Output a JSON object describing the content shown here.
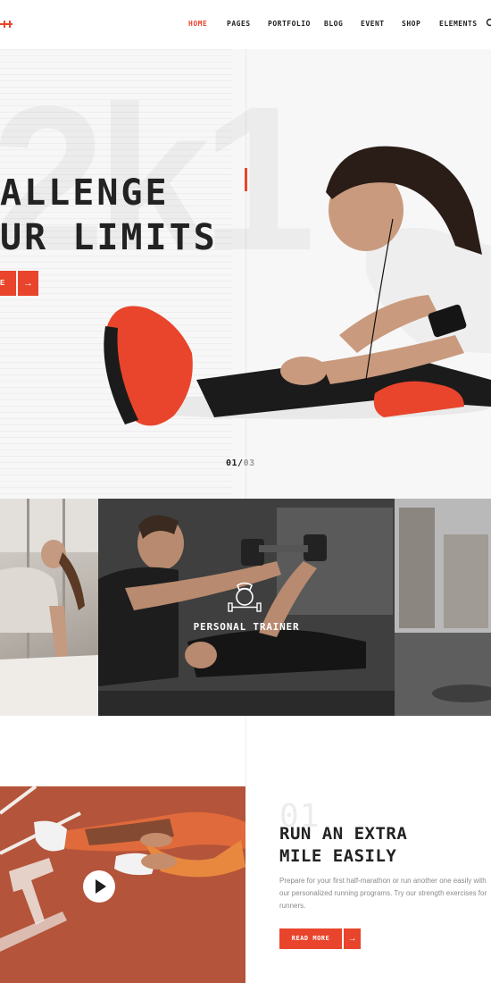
{
  "nav": {
    "items": [
      {
        "label": "HOME",
        "active": true
      },
      {
        "label": "PAGES"
      },
      {
        "label": "PORTFOLIO"
      },
      {
        "label": "BLOG"
      },
      {
        "label": "EVENT"
      },
      {
        "label": "SHOP"
      },
      {
        "label": "ELEMENTS"
      }
    ]
  },
  "hero": {
    "title_line1": "ALLENGE",
    "title_line2": "UR LIMITS",
    "background_text": "2k1",
    "button_label": "E",
    "button_arrow": "→",
    "counter_current": "01/",
    "counter_total": "03"
  },
  "gallery": {
    "center_label": "PERSONAL TRAINER",
    "center_icon": "kettlebell-dumbbell-icon"
  },
  "feature": {
    "number": "01",
    "title_line1": "RUN AN EXTRA",
    "title_line2": "MILE EASILY",
    "text": "Prepare for your first half-marathon or run another one easily with our personalized running programs. Try our strength exercises for runners.",
    "button_label": "READ MORE",
    "button_arrow": "→"
  },
  "colors": {
    "accent": "#e8452c",
    "dark": "#222222",
    "muted": "#8a8a8a"
  }
}
